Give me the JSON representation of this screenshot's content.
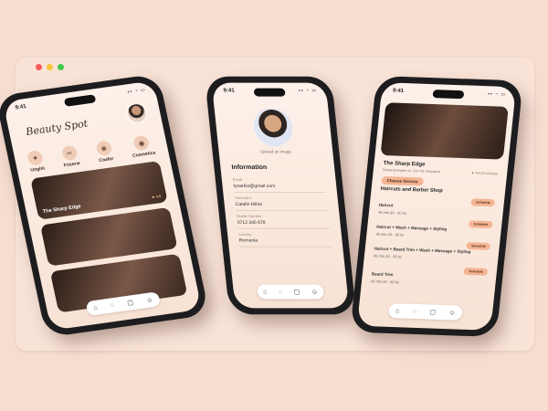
{
  "window": {
    "dots": [
      "red",
      "yellow",
      "green"
    ]
  },
  "status": {
    "time": "9:41",
    "icons": "▪▪ ◔ ▭"
  },
  "phone1": {
    "logo": "Beauty Spot",
    "categories": [
      {
        "label": "Unghii",
        "icon": "nail-icon",
        "glyph": "✦"
      },
      {
        "label": "Frizerie",
        "icon": "scissors-icon",
        "glyph": "✂"
      },
      {
        "label": "Coafor",
        "icon": "hair-icon",
        "glyph": "❀"
      },
      {
        "label": "Cosmetica",
        "icon": "cosmetics-icon",
        "glyph": "◉"
      }
    ],
    "cards": [
      {
        "title": "The Sharp Edge",
        "rating": "★ 4.8"
      },
      {
        "title": "",
        "rating": ""
      },
      {
        "title": "",
        "rating": ""
      }
    ],
    "tabbar": [
      "⌂",
      "◌",
      "▢",
      "☺"
    ]
  },
  "phone2": {
    "upload": "Upload an image",
    "title": "Information",
    "fields": [
      {
        "label": "Email",
        "value": "tynarkin@gmail.com"
      },
      {
        "label": "Username",
        "value": "Catalin Mihai"
      },
      {
        "label": "Mobile Number",
        "value": "0712 345 678"
      },
      {
        "label": "Country",
        "value": "Romania"
      }
    ],
    "tabbar": [
      "⌂",
      "◌",
      "▢",
      "☺"
    ]
  },
  "phone3": {
    "name": "The Sharp Edge",
    "address": "Strada Exemplar 14, 123 735, Bucharest",
    "rating": "★ 4.8 (23 reviews)",
    "choose": "Choose Service",
    "category": "Haircuts and Barber Shop",
    "services": [
      {
        "name": "Haircut",
        "price": "45 min.30 - 60 lei",
        "action": "Schedule"
      },
      {
        "name": "Haircut + Wash + Massage + Styling",
        "price": "45 min.30 - 60 lei",
        "action": "Schedule"
      },
      {
        "name": "Haircut + Beard Trim + Wash + Massage + Styling",
        "price": "45 min.30 - 60 lei",
        "action": "Schedule"
      },
      {
        "name": "Beard Trim",
        "price": "45 min.30 - 60 lei",
        "action": "Schedule"
      }
    ],
    "tabbar": [
      "⌂",
      "◌",
      "▢",
      "☺"
    ]
  }
}
